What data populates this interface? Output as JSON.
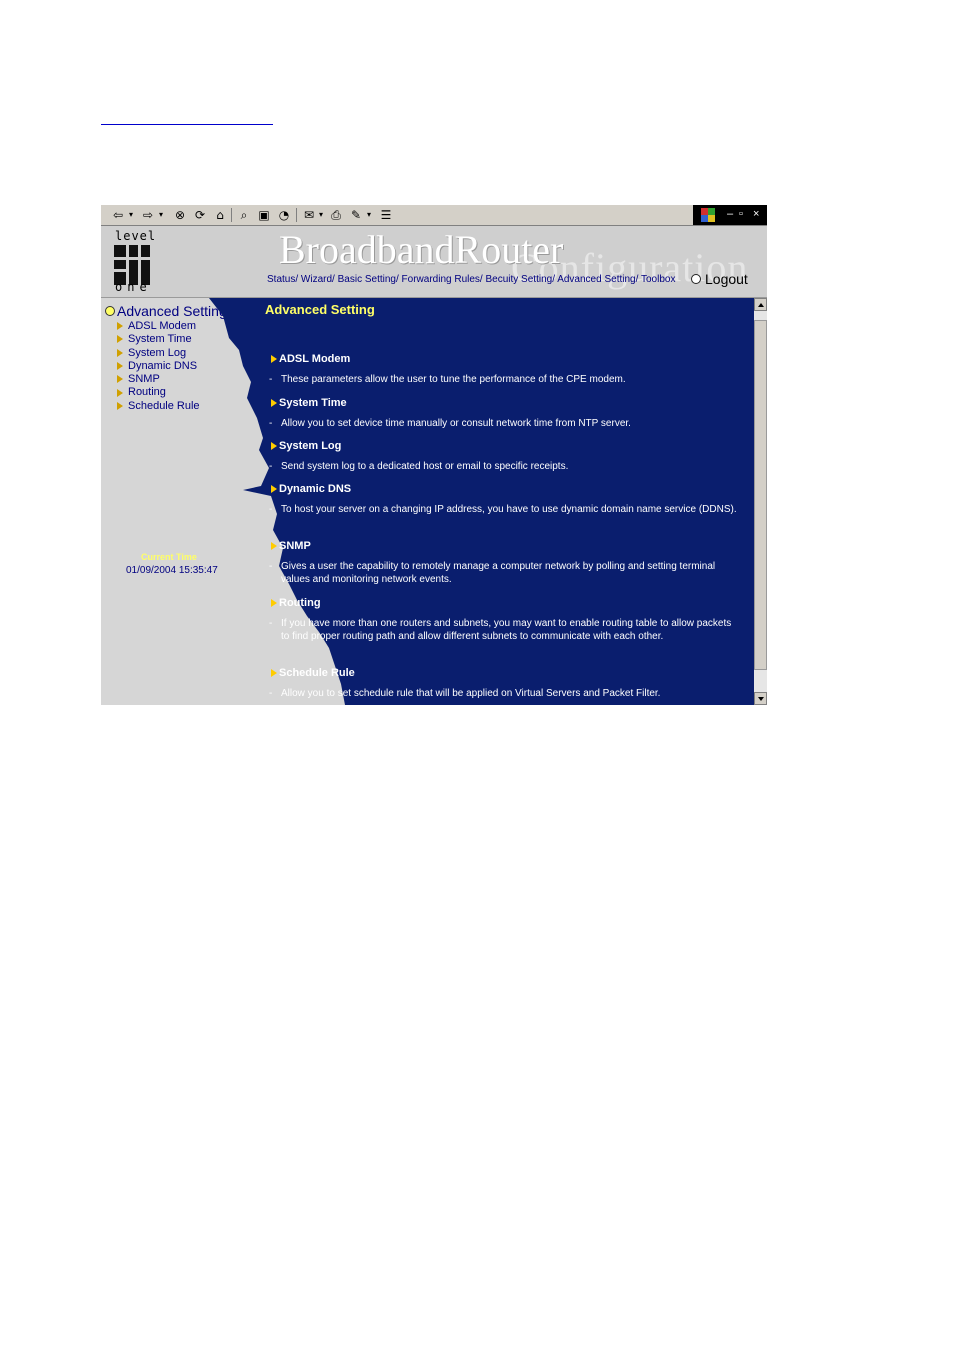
{
  "toolbar": {
    "icons": [
      "back-icon",
      "forward-icon",
      "stop-icon",
      "refresh-icon",
      "home-icon",
      "search-icon",
      "favorites-icon",
      "history-icon",
      "mail-icon",
      "print-icon",
      "edit-icon",
      "discuss-icon"
    ],
    "window_buttons": [
      "–",
      "▫",
      "×"
    ]
  },
  "header": {
    "logo_top": "level",
    "logo_bottom": "one",
    "brand": "BroadbandRouter",
    "brand_sub": "Configuration",
    "nav": [
      "Status/",
      "Wizard/",
      "Basic Setting/",
      "Forwarding Rules/",
      "Becuity Setting/",
      "Advanced Setting/",
      "Toolbox"
    ],
    "logout": "Logout"
  },
  "sidebar": {
    "title": "Advanced Setting",
    "items": [
      "ADSL Modem",
      "System Time",
      "System Log",
      "Dynamic DNS",
      "SNMP",
      "Routing",
      "Schedule Rule"
    ],
    "current_time_label": "Current Time",
    "current_time_value": "01/09/2004 15:35:47"
  },
  "content": {
    "title": "Advanced Setting",
    "sections": [
      {
        "heading": "ADSL Modem",
        "desc": "These parameters allow the user to tune the performance of the CPE modem."
      },
      {
        "heading": "System Time",
        "desc": "Allow you to set device time manually or consult network time from NTP server."
      },
      {
        "heading": "System Log",
        "desc": "Send system log to a dedicated host or email to specific receipts."
      },
      {
        "heading": "Dynamic DNS",
        "desc": "To host your server on a changing IP address, you have to use dynamic domain name service (DDNS)."
      },
      {
        "heading": "SNMP",
        "desc": "Gives a user the capability to remotely manage a computer network by polling and setting terminal values and monitoring network events."
      },
      {
        "heading": "Routing",
        "desc": "If you have more than one routers and subnets, you may want to enable routing table to allow packets to find proper routing path and allow different subnets to communicate with each other."
      },
      {
        "heading": "Schedule Rule",
        "desc": "Allow you to set schedule rule that will be applied on Virtual Servers and Packet Filter."
      }
    ]
  },
  "colors": {
    "content_bg": "#0a1e6e",
    "sidebar_bg": "#d6d6d6",
    "accent_yellow": "#ffff66",
    "nav_blue": "#000080"
  }
}
